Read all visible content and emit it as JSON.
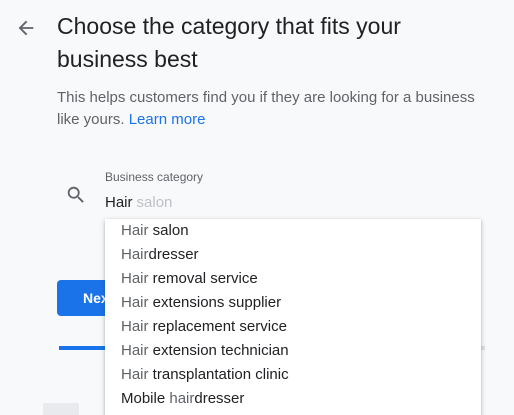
{
  "header": {
    "title": "Choose the category that fits your business best"
  },
  "intro": {
    "text": "This helps customers find you if they are looking for a business like yours.",
    "learn_more": "Learn more"
  },
  "category_field": {
    "label": "Business category",
    "typed": "Hair",
    "suggestion": "salon"
  },
  "dropdown": {
    "options": [
      {
        "match": "Hair",
        "rest": " salon"
      },
      {
        "match": "Hair",
        "rest": "dresser"
      },
      {
        "match": "Hair",
        "rest": " removal service"
      },
      {
        "match": "Hair",
        "rest": " extensions supplier"
      },
      {
        "match": "Hair",
        "rest": " replacement service"
      },
      {
        "match": "Hair",
        "rest": " extension technician"
      },
      {
        "match": "Hair",
        "rest": " transplantation clinic"
      },
      {
        "pre": "Mobile ",
        "match": "hair",
        "rest": "dresser"
      }
    ]
  },
  "next_button": {
    "label": "Next"
  },
  "progress": {
    "fraction": 0.11
  },
  "icons": {
    "back": "arrow-back-icon",
    "search": "search-icon"
  },
  "colors": {
    "accent": "#1a73e8",
    "text": "#202124",
    "muted": "#5f6368"
  }
}
